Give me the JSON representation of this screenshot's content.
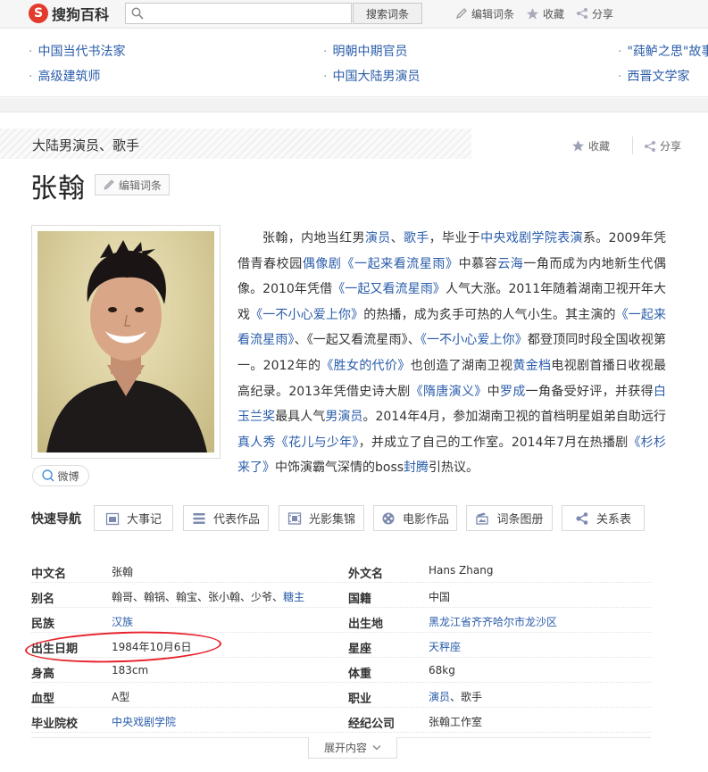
{
  "topbar": {
    "logo_text": "搜狗百科",
    "search_value": "",
    "search_button": "搜索词条",
    "edit_label": "编辑词条",
    "favorite_label": "收藏",
    "share_label": "分享"
  },
  "related": {
    "col1": [
      "中国当代书法家",
      "高级建筑师"
    ],
    "col2": [
      "明朝中期官员",
      "中国大陆男演员"
    ],
    "col3": [
      "\"莼鲈之思\"故事",
      "西晋文学家"
    ]
  },
  "header": {
    "subtitle": "大陆男演员、歌手",
    "favorite_label": "收藏",
    "share_label": "分享",
    "title": "张翰",
    "edit_label": "编辑词条"
  },
  "weibo_label": "微博",
  "summary_segments": [
    {
      "t": "张翰，内地当红男"
    },
    {
      "t": "演员",
      "link": true
    },
    {
      "t": "、"
    },
    {
      "t": "歌手",
      "link": true
    },
    {
      "t": "，毕业于"
    },
    {
      "t": "中央戏剧学院表演",
      "link": true
    },
    {
      "t": "系。2009年凭借青春校园"
    },
    {
      "t": "偶像剧",
      "link": true
    },
    {
      "t": "《一起来看流星雨》",
      "link": true
    },
    {
      "t": "中慕容"
    },
    {
      "t": "云海",
      "link": true
    },
    {
      "t": "一角而成为内地新生代偶像。2010年凭借"
    },
    {
      "t": "《一起又看流星雨》",
      "link": true
    },
    {
      "t": "人气大涨。2011年随着湖南卫视开年大戏"
    },
    {
      "t": "《一不小心爱上你》",
      "link": true
    },
    {
      "t": "的热播，成为炙手可热的人气小生。其主演的"
    },
    {
      "t": "《一起来看流星雨》",
      "link": true
    },
    {
      "t": "、《一起又看流星雨》、"
    },
    {
      "t": "《一不小心爱上你》",
      "link": true
    },
    {
      "t": "都登顶同时段全国收视第一。2012年的"
    },
    {
      "t": "《胜女的代价》",
      "link": true
    },
    {
      "t": "也创造了湖南卫视"
    },
    {
      "t": "黄金档",
      "link": true
    },
    {
      "t": "电视剧首播日收视最高纪录。2013年凭借史诗大剧"
    },
    {
      "t": "《隋唐演义》",
      "link": true
    },
    {
      "t": "中"
    },
    {
      "t": "罗成",
      "link": true
    },
    {
      "t": "一角备受好评，并获得"
    },
    {
      "t": "白玉兰奖",
      "link": true
    },
    {
      "t": "最具人气"
    },
    {
      "t": "男演员",
      "link": true
    },
    {
      "t": "。2014年4月，参加湖南卫视的首档明星姐弟自助远行"
    },
    {
      "t": "真人秀",
      "link": true
    },
    {
      "t": "《花儿与少年》",
      "link": true
    },
    {
      "t": "，并成立了自己的工作室。2014年7月在热播剧"
    },
    {
      "t": "《杉杉来了》",
      "link": true
    },
    {
      "t": "中饰演霸气深情的boss"
    },
    {
      "t": "封腾",
      "link": true
    },
    {
      "t": "引热议。"
    }
  ],
  "quick_nav": {
    "label": "快速导航",
    "items": [
      "大事记",
      "代表作品",
      "光影集锦",
      "电影作品",
      "词条图册",
      "关系表"
    ]
  },
  "info": {
    "left": [
      {
        "k": "中文名",
        "v": "张翰"
      },
      {
        "k": "别名",
        "v": "翰哥、翰锅、翰宝、张小翰、少爷、",
        "link": "糖主"
      },
      {
        "k": "民族",
        "link": "汉族"
      },
      {
        "k": "出生日期",
        "v": "1984年10月6日"
      },
      {
        "k": "身高",
        "v": "183cm"
      },
      {
        "k": "血型",
        "v": "A型"
      },
      {
        "k": "毕业院校",
        "link": "中央戏剧学院"
      }
    ],
    "right": [
      {
        "k": "外文名",
        "v": "Hans Zhang"
      },
      {
        "k": "国籍",
        "v": "中国"
      },
      {
        "k": "出生地",
        "link": "黑龙江省齐齐哈尔市龙沙区"
      },
      {
        "k": "星座",
        "link": "天秤座"
      },
      {
        "k": "体重",
        "v": "68kg"
      },
      {
        "k": "职业",
        "link": "演员",
        "v_after": "、歌手"
      },
      {
        "k": "经纪公司",
        "v": "张翰工作室"
      }
    ]
  },
  "expand_label": "展开内容",
  "colors": {
    "link": "#2a5caa",
    "brand": "#e23b2e",
    "highlight": "#e8202a"
  }
}
